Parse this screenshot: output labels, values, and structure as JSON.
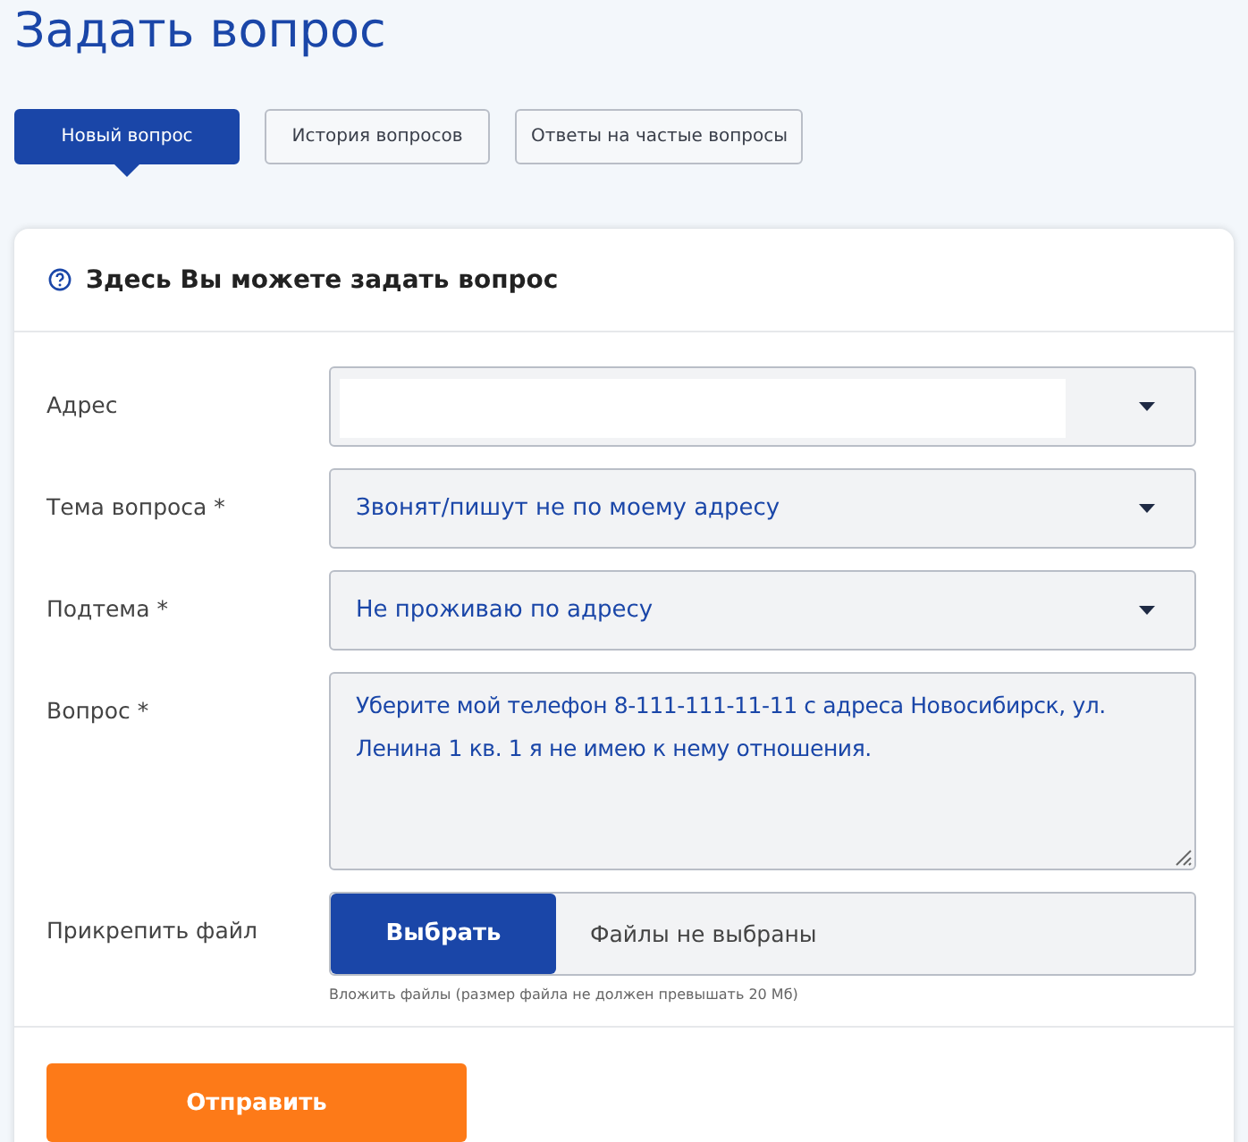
{
  "title": "Задать вопрос",
  "tabs": [
    {
      "label": "Новый вопрос",
      "selected": true
    },
    {
      "label": "История вопросов",
      "selected": false
    },
    {
      "label": "Ответы на частые вопросы",
      "selected": false
    }
  ],
  "card": {
    "heading": "Здесь Вы можете задать вопрос",
    "fields": [
      {
        "kind": "select",
        "label": "Адрес",
        "redacted": true
      },
      {
        "kind": "select",
        "label": "Тема вопроса *",
        "value": "Звонят/пишут не по моему адресу"
      },
      {
        "kind": "select",
        "label": "Подтема *",
        "value": "Не проживаю по адресу"
      },
      {
        "kind": "textarea",
        "label": "Вопрос *",
        "value": "Уберите мой телефон 8-111-111-11-11 с адреса Новосибирск, ул. Ленина 1 кв. 1 я не имею к нему отношения."
      },
      {
        "kind": "file",
        "label": "Прикрепить файл",
        "button": "Выбрать",
        "status": "Файлы не выбраны",
        "hint": "Вложить файлы (размер файла не должен превышать 20 Мб)"
      }
    ],
    "submit": "Отправить"
  }
}
